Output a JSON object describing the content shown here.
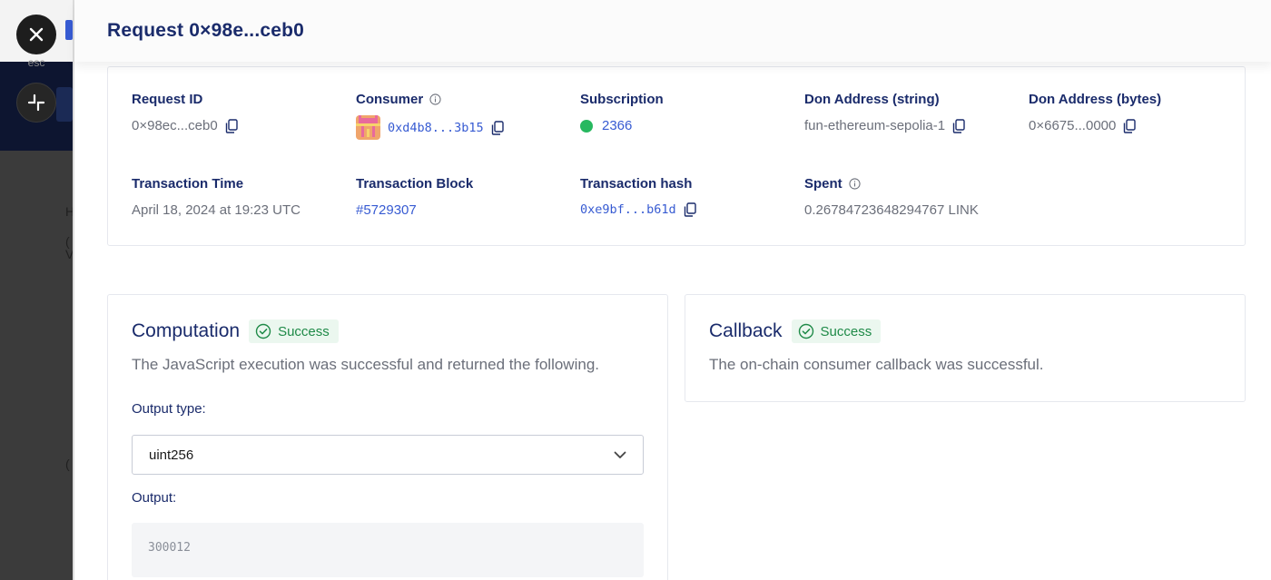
{
  "overlay": {
    "esc_label": "esc",
    "background_fragments": [
      "H",
      "(",
      "V",
      "("
    ]
  },
  "drawer": {
    "title": "Request 0×98e...ceb0"
  },
  "details": {
    "request_id": {
      "label": "Request ID",
      "value": "0×98ec...ceb0"
    },
    "consumer": {
      "label": "Consumer",
      "value": "0xd4b8...3b15"
    },
    "subscription": {
      "label": "Subscription",
      "value": "2366",
      "status_color": "#27b85f"
    },
    "don_address_string": {
      "label": "Don Address (string)",
      "value": "fun-ethereum-sepolia-1"
    },
    "don_address_bytes": {
      "label": "Don Address (bytes)",
      "value": "0×6675...0000"
    },
    "transaction_time": {
      "label": "Transaction Time",
      "value": "April 18, 2024 at 19:23 UTC"
    },
    "transaction_block": {
      "label": "Transaction Block",
      "value": "#5729307"
    },
    "transaction_hash": {
      "label": "Transaction hash",
      "value": "0xe9bf...b61d"
    },
    "spent": {
      "label": "Spent",
      "value": "0.26784723648294767 LINK"
    }
  },
  "computation": {
    "title": "Computation",
    "status": "Success",
    "description": "The JavaScript execution was successful and returned the following.",
    "output_type_label": "Output type:",
    "output_type_value": "uint256",
    "output_label": "Output:",
    "output_value": "300012"
  },
  "callback": {
    "title": "Callback",
    "status": "Success",
    "description": "The on-chain consumer callback was successful."
  },
  "colors": {
    "primary_text": "#1a2b6b",
    "link": "#375bd2",
    "success": "#1f8a48",
    "success_bg": "#ebf7ef"
  },
  "icons": [
    "close-icon",
    "minimize-icon",
    "info-icon",
    "copy-icon",
    "check-circle-icon",
    "chevron-down-icon",
    "avatar"
  ]
}
